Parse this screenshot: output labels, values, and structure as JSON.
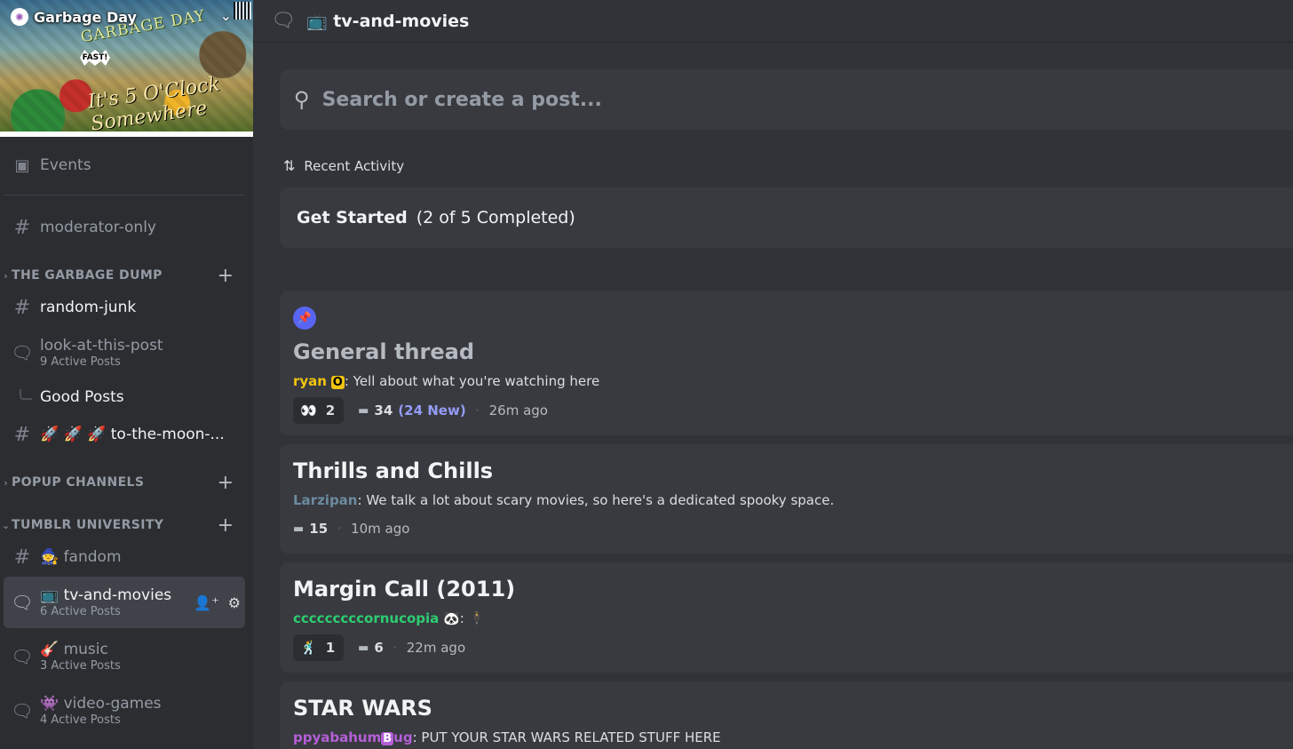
{
  "server": {
    "name": "Garbage Day",
    "banner_text": "GARBAGE DAY",
    "banner_script": "It's 5 O'Clock Somewhere",
    "banner_burst": "FAST!"
  },
  "sidebar": {
    "events_label": "Events",
    "moderator_channel": "moderator-only",
    "categories": [
      {
        "name": "THE GARBAGE DUMP"
      },
      {
        "name": "POPUP CHANNELS"
      },
      {
        "name": "TUMBLR UNIVERSITY"
      }
    ],
    "channels": {
      "random_junk": "random-junk",
      "look_at_this_post": {
        "name": "look-at-this-post",
        "sub": "9 Active Posts"
      },
      "good_posts": "Good Posts",
      "to_the_moon": "🚀 🚀 🚀 to-the-moon-...",
      "fandom": "🧙 fandom",
      "tv_and_movies": {
        "name": "📺 tv-and-movies",
        "sub": "6 Active Posts"
      },
      "music": {
        "name": "🎸 music",
        "sub": "3 Active Posts"
      },
      "video_games": {
        "name": "👾 video-games",
        "sub": "4 Active Posts"
      }
    }
  },
  "header": {
    "channel_title": "📺 tv-and-movies"
  },
  "search": {
    "placeholder": "Search or create a post..."
  },
  "sort": {
    "label": "Recent Activity"
  },
  "get_started": {
    "title": "Get Started",
    "progress": "(2 of 5 Completed)"
  },
  "posts": [
    {
      "title": "General thread",
      "author": "ryan",
      "author_badge": "O",
      "author_color": "#f1c40f",
      "text": ": Yell about what you're watching here",
      "reaction_emoji": "👀",
      "reaction_count": "2",
      "messages": "34",
      "new_messages": "(24 New)",
      "ago": "26m ago"
    },
    {
      "title": "Thrills and Chills",
      "author": "Larzipan",
      "author_color": "#6c8a9e",
      "text": ": We talk a lot about scary movies, so here's a dedicated spooky space.",
      "messages": "15",
      "ago": "10m ago"
    },
    {
      "title": "Margin Call (2011)",
      "author": "cccccccccornucopia",
      "author_color": "#2ecc71",
      "author_emoji": "🐼",
      "text": ":",
      "post_emoji": "🕴",
      "reaction_emoji": "🕺",
      "reaction_count": "1",
      "messages": "6",
      "ago": "22m ago"
    },
    {
      "title": "STAR WARS",
      "author": "ppyabahum",
      "author_badge": "B",
      "badge_suffix": "ug",
      "author_color": "#b45fd6",
      "text": ": PUT YOUR STAR WARS RELATED STUFF HERE"
    }
  ],
  "colors": {
    "accent": "#5865f2",
    "new_messages": "#949cf7"
  }
}
